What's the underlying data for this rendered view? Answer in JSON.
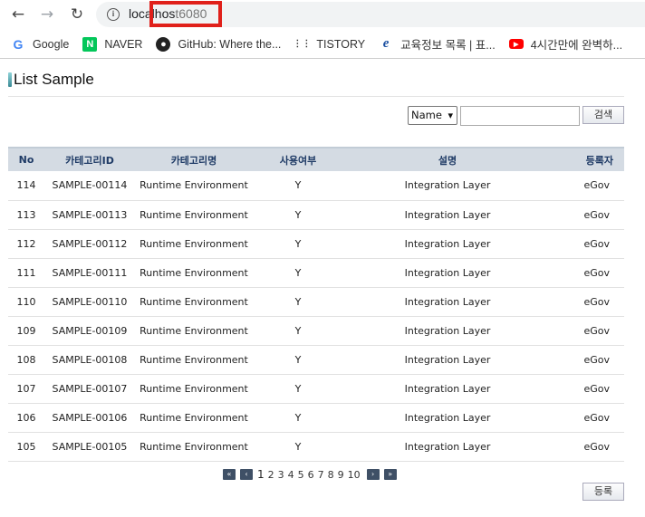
{
  "browser": {
    "url_host": "localhos",
    "url_port": "t6080",
    "bookmarks": [
      {
        "label": "Google",
        "icon": "google-icon"
      },
      {
        "label": "NAVER",
        "icon": "naver-icon"
      },
      {
        "label": "GitHub: Where the...",
        "icon": "github-icon"
      },
      {
        "label": "TISTORY",
        "icon": "tistory-icon"
      },
      {
        "label": "교육정보 목록 | 표...",
        "icon": "edu-icon"
      },
      {
        "label": "4시간만에 완벽하...",
        "icon": "youtube-icon"
      }
    ]
  },
  "page": {
    "title": "List Sample",
    "search": {
      "select_value": "Name",
      "input_value": "",
      "button_label": "검색"
    },
    "table": {
      "columns": [
        "No",
        "카테고리ID",
        "카테고리명",
        "사용여부",
        "설명",
        "등록자"
      ],
      "rows": [
        [
          "114",
          "SAMPLE-00114",
          "Runtime Environment",
          "Y",
          "Integration Layer",
          "eGov"
        ],
        [
          "113",
          "SAMPLE-00113",
          "Runtime Environment",
          "Y",
          "Integration Layer",
          "eGov"
        ],
        [
          "112",
          "SAMPLE-00112",
          "Runtime Environment",
          "Y",
          "Integration Layer",
          "eGov"
        ],
        [
          "111",
          "SAMPLE-00111",
          "Runtime Environment",
          "Y",
          "Integration Layer",
          "eGov"
        ],
        [
          "110",
          "SAMPLE-00110",
          "Runtime Environment",
          "Y",
          "Integration Layer",
          "eGov"
        ],
        [
          "109",
          "SAMPLE-00109",
          "Runtime Environment",
          "Y",
          "Integration Layer",
          "eGov"
        ],
        [
          "108",
          "SAMPLE-00108",
          "Runtime Environment",
          "Y",
          "Integration Layer",
          "eGov"
        ],
        [
          "107",
          "SAMPLE-00107",
          "Runtime Environment",
          "Y",
          "Integration Layer",
          "eGov"
        ],
        [
          "106",
          "SAMPLE-00106",
          "Runtime Environment",
          "Y",
          "Integration Layer",
          "eGov"
        ],
        [
          "105",
          "SAMPLE-00105",
          "Runtime Environment",
          "Y",
          "Integration Layer",
          "eGov"
        ]
      ]
    },
    "pagination": {
      "pages": [
        "1",
        "2",
        "3",
        "4",
        "5",
        "6",
        "7",
        "8",
        "9",
        "10"
      ],
      "current": "1"
    },
    "register_label": "등록"
  },
  "colors": {
    "highlight": "#e0201a",
    "header_bg": "#d4dbe3",
    "header_text": "#1f3b66",
    "pager_btn": "#3f5066"
  }
}
